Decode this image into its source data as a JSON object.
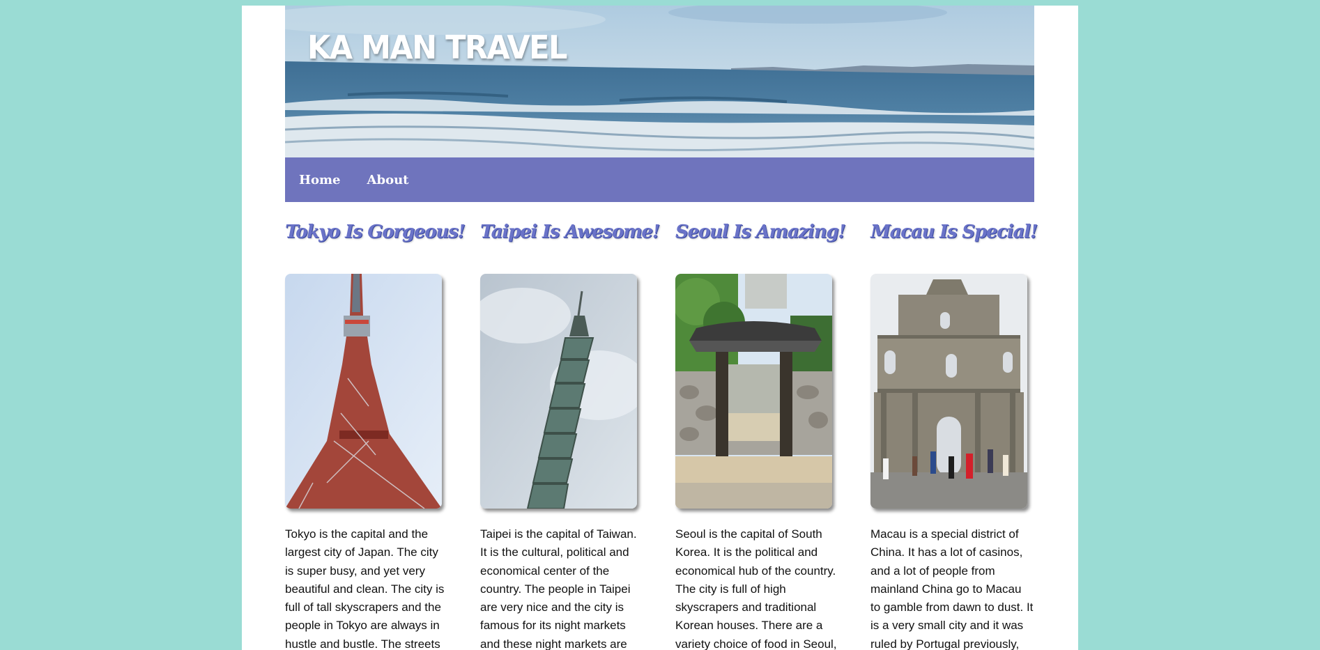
{
  "site": {
    "title": "KA MAN TRAVEL",
    "banner_image": "ocean-waves-banner"
  },
  "nav": {
    "items": [
      {
        "label": "Home"
      },
      {
        "label": "About"
      }
    ]
  },
  "posts": [
    {
      "title": "Tokyo Is Gorgeous!",
      "image": "tokyo-tower-photo",
      "text": "Tokyo is the capital and the largest city of Japan. The city is super busy, and yet very beautiful and clean. The city is full of tall skyscrapers and the people in Tokyo are always in hustle and bustle. The streets"
    },
    {
      "title": "Taipei Is Awesome!",
      "image": "taipei-101-photo",
      "text": "Taipei is the capital of Taiwan. It is the cultural, political and economical center of the country. The people in Taipei are very nice and the city is famous for its night markets and these night markets are"
    },
    {
      "title": "Seoul Is Amazing!",
      "image": "korean-gate-photo",
      "text": "Seoul is the capital of South Korea. It is the political and economical hub of the country. The city is full of high skyscrapers and traditional Korean houses. There are a variety choice of food in Seoul,"
    },
    {
      "title": "Macau Is Special!",
      "image": "ruins-of-st-paul-photo",
      "text": "Macau is a special district of China. It has a lot of casinos, and a lot of people from mainland China go to Macau to gamble from dawn to dust. It is a very small city and it was ruled by Portugal previously,"
    }
  ],
  "colors": {
    "background": "#9adcd4",
    "nav": "#6f74bd",
    "heading": "#6a73c8"
  }
}
